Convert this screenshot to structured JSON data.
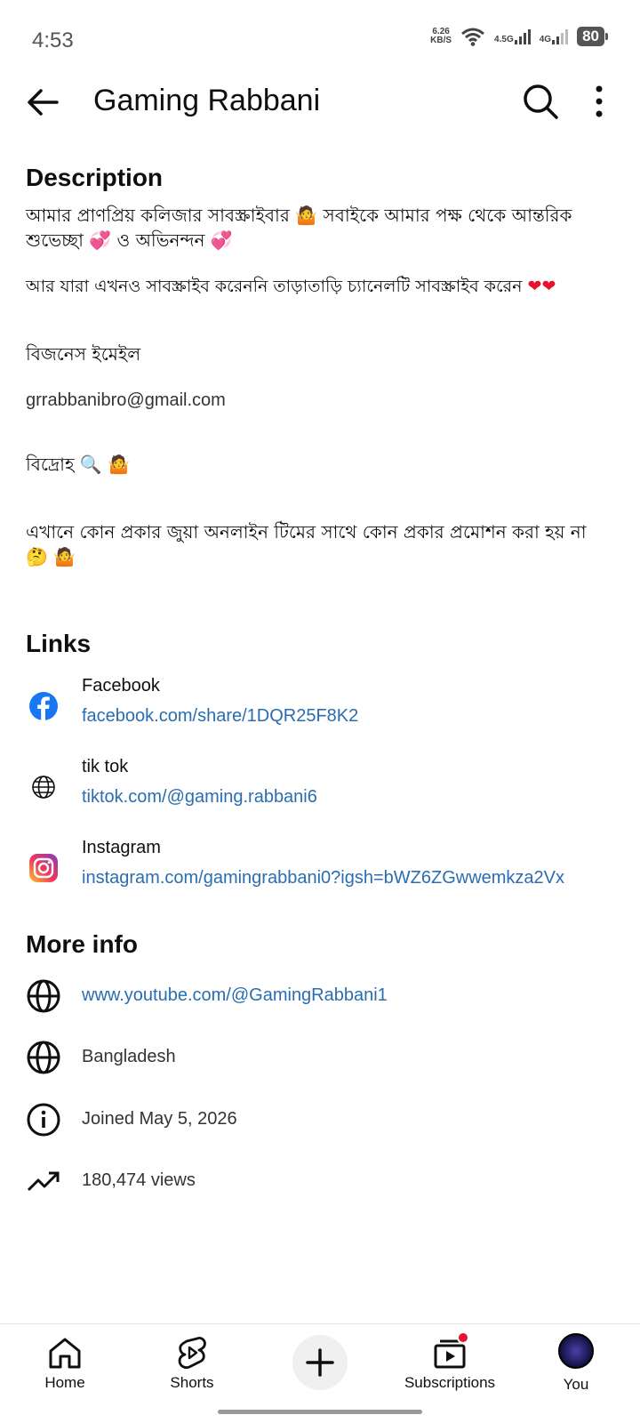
{
  "status": {
    "time": "4:53",
    "net_speed_value": "6.26",
    "net_speed_unit": "KB/S",
    "sim1": "4.5G",
    "sim2": "4G",
    "battery": "80"
  },
  "appbar": {
    "title": "Gaming Rabbani"
  },
  "description": {
    "heading": "Description",
    "lines": [
      "আমার প্রাণপ্রিয় কলিজার সাবস্ক্রাইবার",
      "সবাইকে আমার পক্ষ থেকে আন্তরিক",
      "শুভেচ্ছা",
      "ও অভিনন্দন",
      "আর যারা এখনও সাবস্ক্রাইব করেননি তাড়াতাড়ি চ্যানেলটি সাবস্ক্রাইব করেন",
      "বিজনেস ইমেইল",
      "grrabbanibro@gmail.com",
      "বিদ্রোহ",
      "এখানে কোন প্রকার জুয়া অনলাইন টিমের সাথে কোন প্রকার প্রমোশন করা হয় না"
    ],
    "emoji_shrug": "🤷",
    "emoji_hearts": "💞",
    "emoji_red_heart": "❤❤",
    "emoji_search": "🔍",
    "emoji_think": "🤔"
  },
  "links": {
    "heading": "Links",
    "items": [
      {
        "title": "Facebook",
        "url": "facebook.com/share/1DQR25F8K2",
        "icon": "facebook-icon"
      },
      {
        "title": "tik tok",
        "url": "tiktok.com/@gaming.rabbani6",
        "icon": "globe-icon"
      },
      {
        "title": "Instagram",
        "url": "instagram.com/gamingrabbani0?igsh=bWZ6ZGwwemkza2Vx",
        "icon": "instagram-icon"
      }
    ]
  },
  "more_info": {
    "heading": "More info",
    "channel_url": "www.youtube.com/@GamingRabbani1",
    "country": "Bangladesh",
    "joined": "Joined May 5, 2026",
    "views": "180,474 views"
  },
  "nav": {
    "home": "Home",
    "shorts": "Shorts",
    "subscriptions": "Subscriptions",
    "you": "You"
  },
  "colors": {
    "link": "#2a6db0",
    "facebook": "#1877f2",
    "notification": "#e8122d"
  }
}
